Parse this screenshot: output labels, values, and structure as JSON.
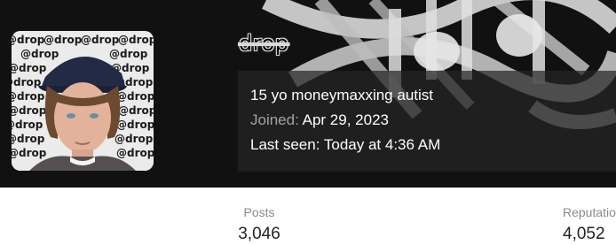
{
  "profile": {
    "username": "drop",
    "tagline": "15 yo moneymaxxing autist",
    "joined_label": "Joined:",
    "joined_value": "Apr 29, 2023",
    "last_seen_label": "Last seen:",
    "last_seen_value": "Today at 4:36 AM",
    "avatar_pattern_text": "@drop"
  },
  "stats": {
    "posts_label": "Posts",
    "posts_value": "3,046",
    "reputation_label": "Reputation",
    "reputation_value": "4,052"
  },
  "colors": {
    "banner_bg": "#101010",
    "panel_bg": "#262626",
    "muted_text": "#a3a3a3"
  }
}
